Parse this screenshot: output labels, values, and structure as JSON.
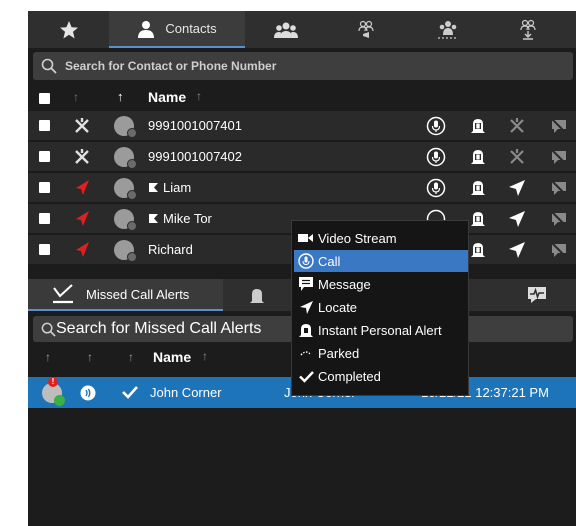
{
  "top_tabs": [
    {
      "icon": "star-icon",
      "label": ""
    },
    {
      "icon": "contact-person-icon",
      "label": "Contacts"
    },
    {
      "icon": "group-icon",
      "label": ""
    },
    {
      "icon": "group-broadcast-icon",
      "label": ""
    },
    {
      "icon": "group-dynamic-icon",
      "label": ""
    },
    {
      "icon": "group-download-icon",
      "label": ""
    }
  ],
  "contacts": {
    "search_placeholder": "Search for Contact or Phone Number",
    "header": {
      "sort1": "↑",
      "sort2": "↑",
      "name": "Name",
      "name_sort": "↑"
    },
    "rows": [
      {
        "name": "9991001007401",
        "status": "offline",
        "flag": false
      },
      {
        "name": "9991001007402",
        "status": "offline",
        "flag": false
      },
      {
        "name": "Liam",
        "status": "online",
        "flag": true
      },
      {
        "name": "Mike Tor",
        "status": "online",
        "flag": true
      },
      {
        "name": "Richard",
        "status": "online",
        "flag": false
      }
    ]
  },
  "bottom_tabs": {
    "missed": "Missed Call Alerts"
  },
  "missed": {
    "search_placeholder": "Search for Missed Call Alerts",
    "header": {
      "sort1": "↑",
      "sort2": "↑",
      "sort3": "↑",
      "name": "Name",
      "name_sort": "↑",
      "date_partial": "e",
      "date_sort": "↓"
    },
    "rows": [
      {
        "name": "John Corner",
        "contact": "John Corner",
        "date": "10/21/21 12:37:21 PM"
      }
    ]
  },
  "context_menu": [
    {
      "icon": "video-stream-icon",
      "label": "Video Stream",
      "highlight": false
    },
    {
      "icon": "call-icon",
      "label": "Call",
      "highlight": true
    },
    {
      "icon": "message-icon",
      "label": "Message",
      "highlight": false
    },
    {
      "icon": "locate-icon",
      "label": "Locate",
      "highlight": false
    },
    {
      "icon": "instant-personal-alert-icon",
      "label": "Instant Personal Alert",
      "highlight": false
    },
    {
      "icon": "parked-icon",
      "label": "Parked",
      "highlight": false
    },
    {
      "icon": "completed-check-icon",
      "label": "Completed",
      "highlight": false
    }
  ],
  "colors": {
    "accent": "#5a8fd0",
    "selected_row": "#1d74b8",
    "menu_highlight": "#3b78c4",
    "alert_red": "#e02020",
    "check_green": "#3cb043"
  }
}
